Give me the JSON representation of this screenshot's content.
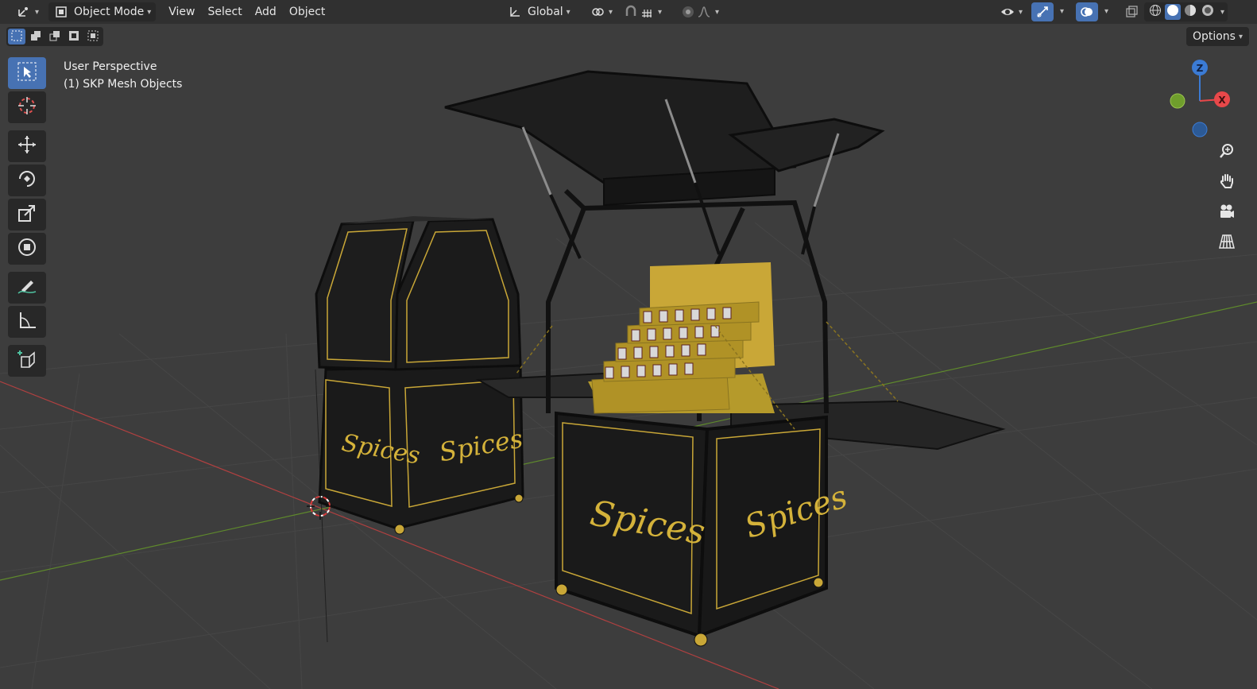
{
  "header": {
    "editor_type_icon": "3d-viewport-icon",
    "mode": "Object Mode",
    "menus": [
      "View",
      "Select",
      "Add",
      "Object"
    ],
    "transform_orientation": "Global",
    "options_label": "Options"
  },
  "viewport": {
    "perspective": "User Perspective",
    "collection": "(1) SKP Mesh Objects",
    "cart_label": "Spices"
  },
  "gizmo": {
    "z_label": "Z",
    "x_label": "X",
    "x_color": "#e8484a",
    "y_color": "#6f9e2c",
    "z_color": "#3b7bd4"
  },
  "toolbar": {
    "tools": [
      "select-box",
      "cursor",
      "move",
      "rotate",
      "scale",
      "transform",
      "annotate",
      "measure",
      "add-cube"
    ],
    "active": "select-box"
  },
  "colors": {
    "accent": "#4772b3",
    "gold": "#d4b23a",
    "background": "#3d3d3d"
  }
}
